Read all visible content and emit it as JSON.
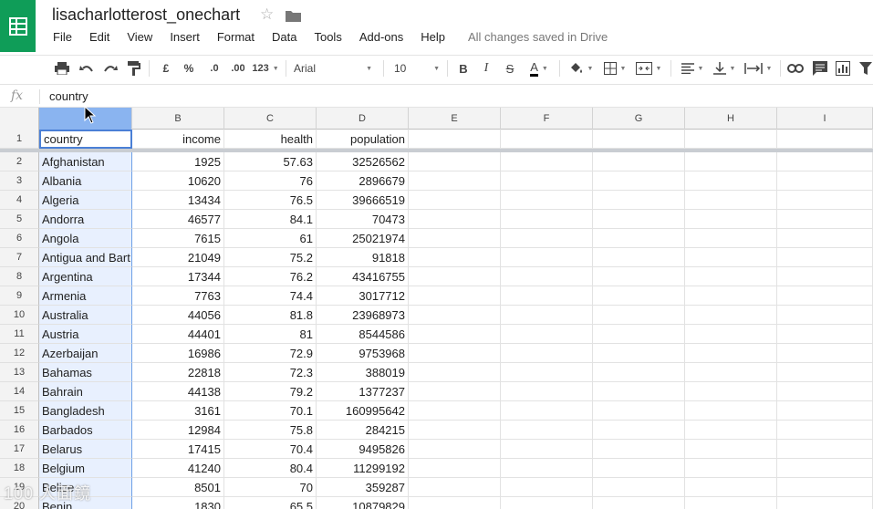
{
  "header": {
    "doc_title": "lisacharlotterost_onechart",
    "save_status": "All changes saved in Drive"
  },
  "menu": [
    "File",
    "Edit",
    "View",
    "Insert",
    "Format",
    "Data",
    "Tools",
    "Add-ons",
    "Help"
  ],
  "toolbar": {
    "currency": "£",
    "percent": "%",
    "decrease_decimals": ".0",
    "increase_decimals": ".00",
    "number_format": "123",
    "font": "Arial",
    "font_size": "10",
    "bold": "B",
    "italic": "I",
    "strike": "S",
    "text_color": "A"
  },
  "formula_bar": {
    "fx": "fx",
    "value": "country"
  },
  "columns": [
    "",
    "B",
    "C",
    "D",
    "E",
    "F",
    "G",
    "H",
    "I"
  ],
  "header_row": {
    "num": "1",
    "country": "country",
    "income": "income",
    "health": "health",
    "population": "population"
  },
  "rows": [
    {
      "num": "2",
      "country": "Afghanistan",
      "income": "1925",
      "health": "57.63",
      "population": "32526562"
    },
    {
      "num": "3",
      "country": "Albania",
      "income": "10620",
      "health": "76",
      "population": "2896679"
    },
    {
      "num": "4",
      "country": "Algeria",
      "income": "13434",
      "health": "76.5",
      "population": "39666519"
    },
    {
      "num": "5",
      "country": "Andorra",
      "income": "46577",
      "health": "84.1",
      "population": "70473"
    },
    {
      "num": "6",
      "country": "Angola",
      "income": "7615",
      "health": "61",
      "population": "25021974"
    },
    {
      "num": "7",
      "country": "Antigua and Bart",
      "income": "21049",
      "health": "75.2",
      "population": "91818"
    },
    {
      "num": "8",
      "country": "Argentina",
      "income": "17344",
      "health": "76.2",
      "population": "43416755"
    },
    {
      "num": "9",
      "country": "Armenia",
      "income": "7763",
      "health": "74.4",
      "population": "3017712"
    },
    {
      "num": "10",
      "country": "Australia",
      "income": "44056",
      "health": "81.8",
      "population": "23968973"
    },
    {
      "num": "11",
      "country": "Austria",
      "income": "44401",
      "health": "81",
      "population": "8544586"
    },
    {
      "num": "12",
      "country": "Azerbaijan",
      "income": "16986",
      "health": "72.9",
      "population": "9753968"
    },
    {
      "num": "13",
      "country": "Bahamas",
      "income": "22818",
      "health": "72.3",
      "population": "388019"
    },
    {
      "num": "14",
      "country": "Bahrain",
      "income": "44138",
      "health": "79.2",
      "population": "1377237"
    },
    {
      "num": "15",
      "country": "Bangladesh",
      "income": "3161",
      "health": "70.1",
      "population": "160995642"
    },
    {
      "num": "16",
      "country": "Barbados",
      "income": "12984",
      "health": "75.8",
      "population": "284215"
    },
    {
      "num": "17",
      "country": "Belarus",
      "income": "17415",
      "health": "70.4",
      "population": "9495826"
    },
    {
      "num": "18",
      "country": "Belgium",
      "income": "41240",
      "health": "80.4",
      "population": "11299192"
    },
    {
      "num": "19",
      "country": "Belize",
      "income": "8501",
      "health": "70",
      "population": "359287"
    },
    {
      "num": "20",
      "country": "Benin",
      "income": "1830",
      "health": "65.5",
      "population": "10879829"
    }
  ],
  "colors": {
    "brand_green": "#0f9d58",
    "selected_column": "#8ab4f0",
    "selected_cells": "#e8f0fe"
  },
  "watermark": "100 人面鏡"
}
